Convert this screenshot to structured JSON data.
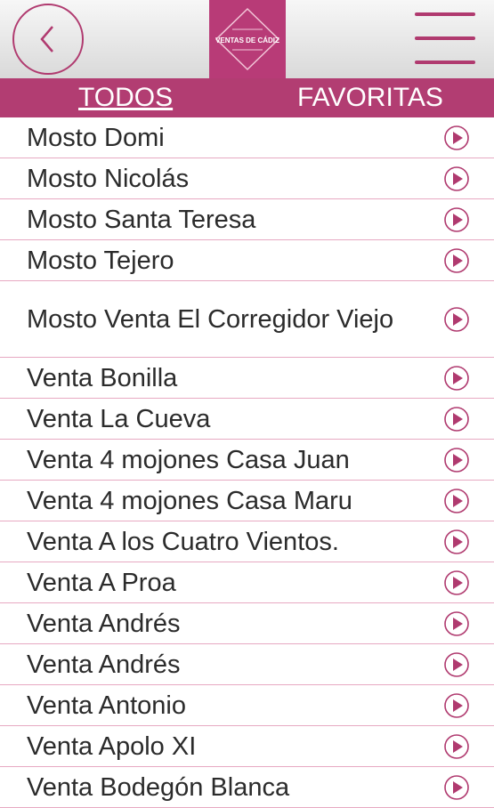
{
  "header": {
    "back_icon": "chevron-left-icon",
    "logo": {
      "text": "VENTAS DE CÁDIZ"
    },
    "menu_icon": "hamburger-menu-icon",
    "accent_color": "#b23d72"
  },
  "tabs": [
    {
      "label": "TODOS",
      "active": true
    },
    {
      "label": "FAVORITAS",
      "active": false
    }
  ],
  "list": {
    "item_icon": "play-circle-icon",
    "items": [
      {
        "label": "Mosto Domi"
      },
      {
        "label": "Mosto Nicolás"
      },
      {
        "label": "Mosto Santa Teresa"
      },
      {
        "label": "Mosto Tejero"
      },
      {
        "label": "Mosto Venta El Corregidor Viejo"
      },
      {
        "label": "Venta Bonilla"
      },
      {
        "label": "Venta La Cueva"
      },
      {
        "label": "Venta 4 mojones Casa Juan"
      },
      {
        "label": "Venta 4 mojones Casa Maru"
      },
      {
        "label": "Venta A los Cuatro Vientos."
      },
      {
        "label": "Venta A Proa"
      },
      {
        "label": "Venta Andrés"
      },
      {
        "label": "Venta Andrés"
      },
      {
        "label": "Venta Antonio"
      },
      {
        "label": "Venta Apolo XI"
      },
      {
        "label": "Venta Bodegón Blanca"
      }
    ]
  }
}
